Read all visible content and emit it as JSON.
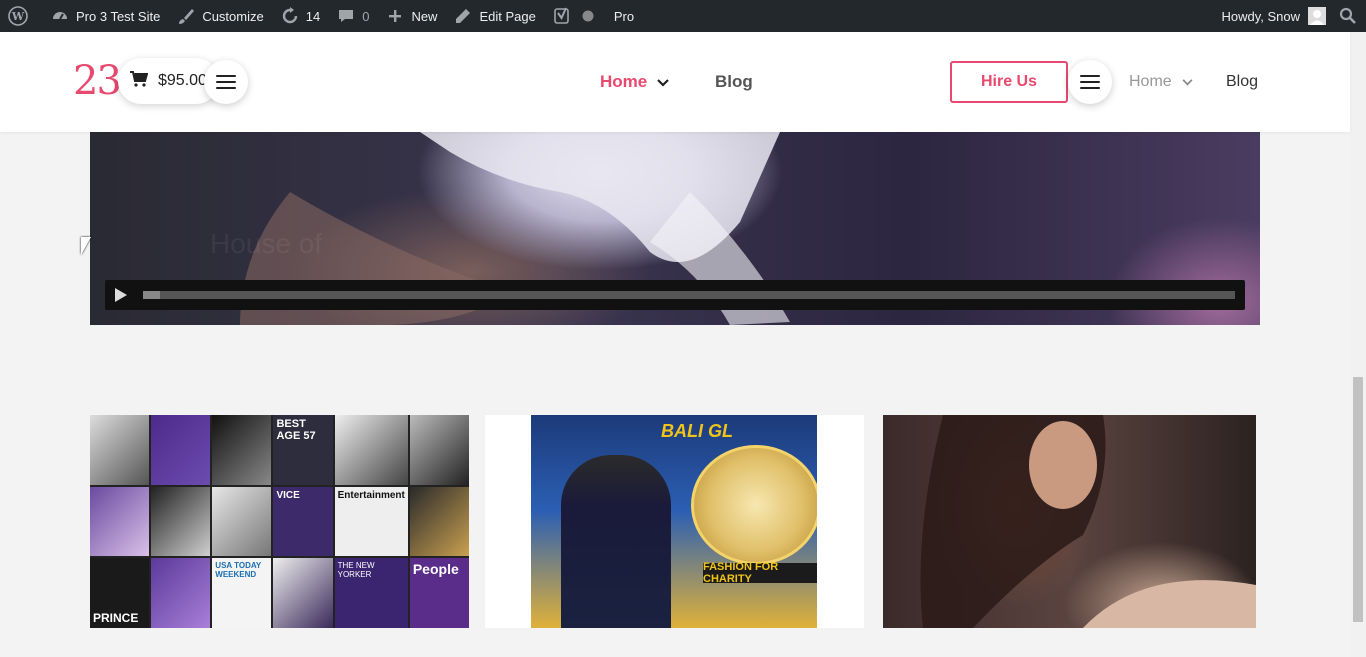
{
  "admin_bar": {
    "site_name": "Pro 3 Test Site",
    "customize": "Customize",
    "updates": "14",
    "comments": "0",
    "new": "New",
    "edit_page": "Edit Page",
    "pro": "Pro",
    "howdy": "Howdy, Snow",
    "icons": [
      "wordpress-icon",
      "dashboard-icon",
      "brush-icon",
      "update-icon",
      "comment-icon",
      "plus-icon",
      "pencil-icon",
      "yoast-icon",
      "status-dot-icon",
      "search-icon"
    ]
  },
  "header": {
    "logo": "23",
    "cart_total": "$95.00",
    "nav_main": [
      {
        "label": "Home"
      },
      {
        "label": "Blog"
      }
    ],
    "hire_button": "Hire Us",
    "nav_secondary": [
      {
        "label": "Home"
      },
      {
        "label": "Blog"
      }
    ],
    "accent_color": "#e8496f"
  },
  "video": {
    "title_overlay": "House of",
    "progress": 0
  },
  "thumbnails": {
    "news_banner": "FASHION FOR CHARITY",
    "news_logo": "BALI GL",
    "collage_labels": [
      "BEST AGE 57",
      "VICE",
      "Entertainment",
      "PRINCE",
      "USA TODAY WEEKEND",
      "People",
      "THE NEW YORKER"
    ]
  }
}
